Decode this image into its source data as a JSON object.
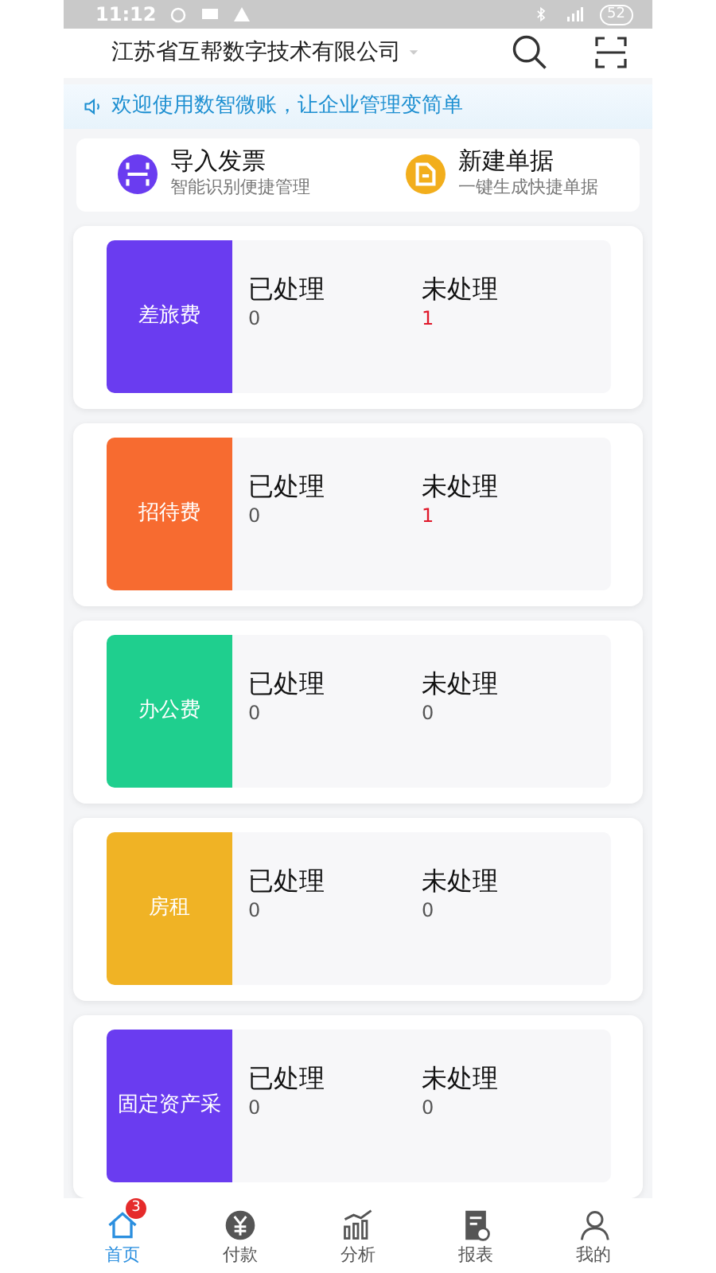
{
  "status_bar": {
    "time": "11:12",
    "battery": "52"
  },
  "header": {
    "company": "江苏省互帮数字技术有限公司"
  },
  "notice": "欢迎使用数智微账，让企业管理变简单",
  "actions": [
    {
      "kind": "scan",
      "title": "导入发票",
      "subtitle": "智能识别便捷管理",
      "color": "#6a3cf0"
    },
    {
      "kind": "doc",
      "title": "新建单据",
      "subtitle": "一键生成快捷单据",
      "color": "#f2ae1c"
    }
  ],
  "categories": [
    {
      "name": "差旅费",
      "color": "#6a3cf0",
      "processed_label": "已处理",
      "processed": "0",
      "pending_label": "未处理",
      "pending": "1",
      "pending_alert": true
    },
    {
      "name": "招待费",
      "color": "#f76b30",
      "processed_label": "已处理",
      "processed": "0",
      "pending_label": "未处理",
      "pending": "1",
      "pending_alert": true
    },
    {
      "name": "办公费",
      "color": "#1fcf8e",
      "processed_label": "已处理",
      "processed": "0",
      "pending_label": "未处理",
      "pending": "0",
      "pending_alert": false
    },
    {
      "name": "房租",
      "color": "#f0b325",
      "processed_label": "已处理",
      "processed": "0",
      "pending_label": "未处理",
      "pending": "0",
      "pending_alert": false
    },
    {
      "name": "固定资产采",
      "color": "#6a3cf0",
      "processed_label": "已处理",
      "processed": "0",
      "pending_label": "未处理",
      "pending": "0",
      "pending_alert": false
    }
  ],
  "tabs": [
    {
      "kind": "home",
      "label": "首页",
      "selected": true,
      "badge": "3"
    },
    {
      "kind": "pay",
      "label": "付款",
      "selected": false
    },
    {
      "kind": "chart",
      "label": "分析",
      "selected": false
    },
    {
      "kind": "report",
      "label": "报表",
      "selected": false
    },
    {
      "kind": "user",
      "label": "我的",
      "selected": false
    }
  ]
}
